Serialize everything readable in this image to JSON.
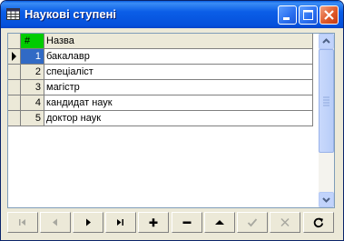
{
  "window": {
    "title": "Наукові ступені"
  },
  "table": {
    "columns": [
      "#",
      "Назва"
    ],
    "rows": [
      {
        "id": "1",
        "name": "бакалавр"
      },
      {
        "id": "2",
        "name": "спеціаліст"
      },
      {
        "id": "3",
        "name": "магістр"
      },
      {
        "id": "4",
        "name": "кандидат наук"
      },
      {
        "id": "5",
        "name": "доктор наук"
      }
    ]
  },
  "selected_row": 1,
  "colors": {
    "id_header": "#00cc00",
    "selection": "#316ac5",
    "title_bar": "#0b5ee7"
  },
  "navigator": [
    "first-icon",
    "prior-icon",
    "next-icon",
    "last-icon",
    "insert-icon",
    "delete-icon",
    "edit-icon",
    "post-icon",
    "cancel-icon",
    "refresh-icon"
  ]
}
